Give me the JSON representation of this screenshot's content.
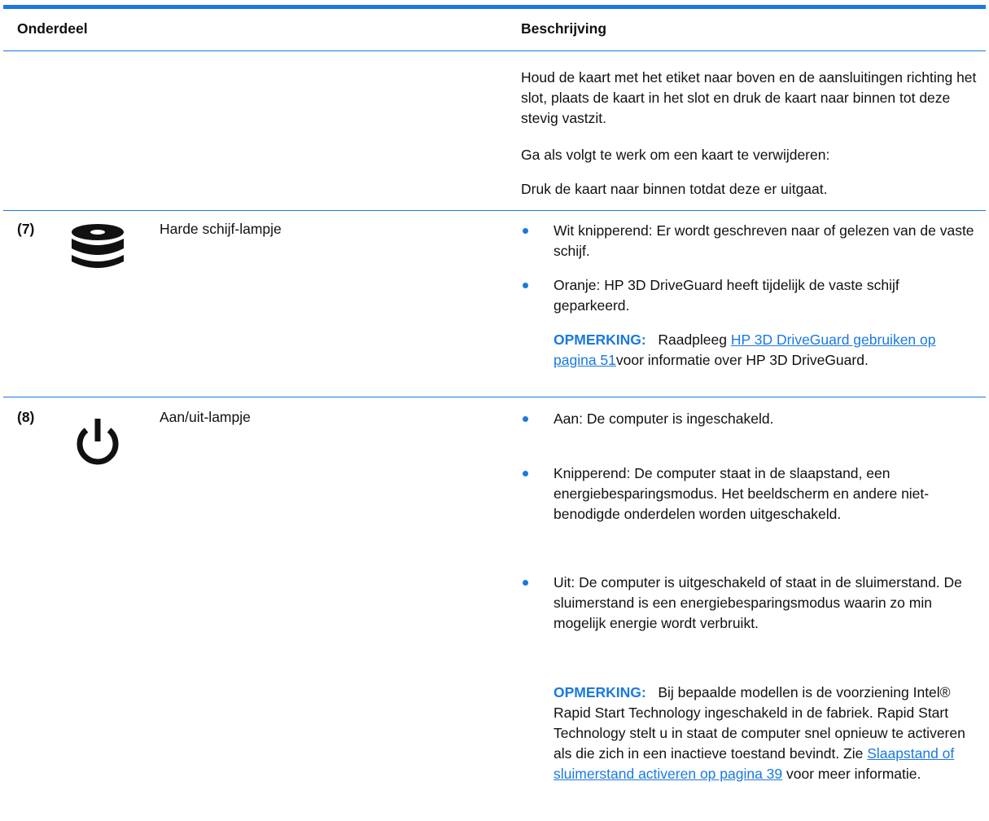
{
  "header": {
    "col1": "Onderdeel",
    "col2": "Beschrijving"
  },
  "intro": {
    "p1": "Houd de kaart met het etiket naar boven en de aansluitingen richting het slot, plaats de kaart in het slot en druk de kaart naar binnen tot deze stevig vastzit.",
    "p2": "Ga als volgt te werk om een kaart te verwijderen:",
    "p3": "Druk de kaart naar binnen totdat deze er uitgaat."
  },
  "rows": [
    {
      "num": "(7)",
      "icon": "hard-drive-icon",
      "name": "Harde schijf-lampje",
      "bullets": [
        "Wit knipperend: Er wordt geschreven naar of gelezen van de vaste schijf.",
        "Oranje: HP 3D DriveGuard heeft tijdelijk de vaste schijf geparkeerd."
      ],
      "note": {
        "label": "OPMERKING:",
        "pre": "Raadpleeg",
        "link": "HP 3D DriveGuard gebruiken op pagina 51",
        "post": "voor informatie over HP 3D DriveGuard."
      }
    },
    {
      "num": "(8)",
      "icon": "power-icon",
      "name": "Aan/uit-lampje",
      "bullets": [
        "Aan: De computer is ingeschakeld.",
        "Knipperend: De computer staat in de slaapstand, een energiebesparingsmodus. Het beeldscherm en andere niet-benodigde onderdelen worden uitgeschakeld.",
        "Uit: De computer is uitgeschakeld of staat in de sluimerstand. De sluimerstand is een energiebesparingsmodus waarin zo min mogelijk energie wordt verbruikt."
      ],
      "note": {
        "label": "OPMERKING:",
        "pre": "Bij bepaalde modellen is de voorziening Intel® Rapid Start Technology ingeschakeld in de fabriek. Rapid Start Technology stelt u in staat de computer snel opnieuw te activeren als die zich in een inactieve toestand bevindt. Zie",
        "link": "Slaapstand of sluimerstand activeren op pagina 39",
        "post": "voor meer informatie."
      }
    }
  ],
  "colors": {
    "accent": "#1a79e0",
    "text": "#111111"
  }
}
